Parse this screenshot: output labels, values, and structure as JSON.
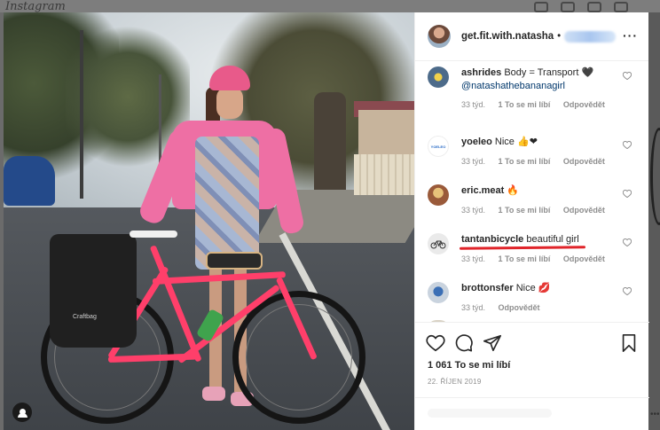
{
  "background": {
    "logo_text": "Instagram",
    "overlay_color": "#6b6b6b"
  },
  "post": {
    "author": {
      "username": "get.fit.with.natasha",
      "separator": "•",
      "follow_label_blurred": true
    },
    "more_icon": "more-horizontal-icon",
    "photo": {
      "description_tag": "user-tag-icon"
    },
    "comments": [
      {
        "username": "ashrides",
        "text": "Body = Transport",
        "emoji": "🖤",
        "mention": "@natashathebananagirl",
        "time": "33 týd.",
        "likes": "1 To se mi líbí",
        "reply": "Odpovědět",
        "avatar_color": "#4d6b8a"
      },
      {
        "username": "yoeleo",
        "text": "Nice",
        "emoji": "👍❤",
        "time": "33 týd.",
        "likes": "1 To se mi líbí",
        "reply": "Odpovědět",
        "avatar_color": "#ffffff"
      },
      {
        "username": "eric.meat",
        "text": "",
        "emoji": "🔥",
        "time": "33 týd.",
        "likes": "1 To se mi líbí",
        "reply": "Odpovědět",
        "avatar_color": "#9a5a3a"
      },
      {
        "username": "tantanbicycle",
        "text": "beautiful girl",
        "emoji": "",
        "time": "33 týd.",
        "likes": "1 To se mi líbí",
        "reply": "Odpovědět",
        "avatar_color": "#e6e6e6",
        "highlighted": true,
        "highlight_color": "#e0242a"
      },
      {
        "username": "brottonsfer",
        "text": "Nice",
        "emoji": "💋",
        "time": "33 týd.",
        "reply": "Odpovědět",
        "avatar_color": "#c9d3de"
      }
    ],
    "actions": {
      "like_icon": "heart-icon",
      "comment_icon": "comment-icon",
      "share_icon": "paper-plane-icon",
      "save_icon": "bookmark-icon"
    },
    "likes_count": "1 061 To se mi líbí",
    "date": "22. ŘÍJEN 2019"
  }
}
